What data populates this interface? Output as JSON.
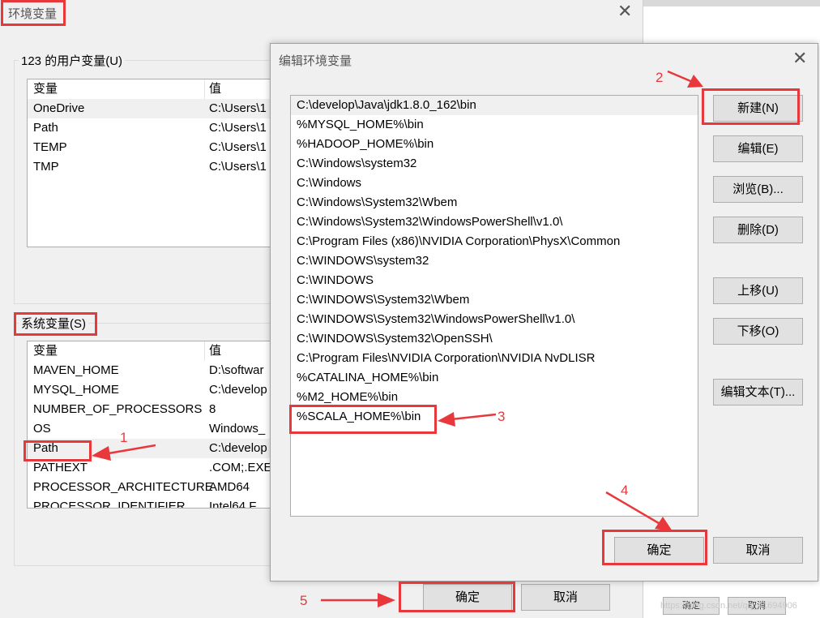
{
  "background_window": {
    "ok_label": "确定",
    "cancel_label": "取消",
    "watermark": "https://blog.csdn.net/qq_41694906"
  },
  "env_dialog": {
    "title": "环境变量",
    "user_section": {
      "label": "123 的用户变量(U)",
      "columns": [
        "变量",
        "值"
      ],
      "rows": [
        {
          "name": "OneDrive",
          "value": "C:\\Users\\1"
        },
        {
          "name": "Path",
          "value": "C:\\Users\\1"
        },
        {
          "name": "TEMP",
          "value": "C:\\Users\\1"
        },
        {
          "name": "TMP",
          "value": "C:\\Users\\1"
        }
      ]
    },
    "system_section": {
      "label": "系统变量(S)",
      "columns": [
        "变量",
        "值"
      ],
      "rows": [
        {
          "name": "MAVEN_HOME",
          "value": "D:\\softwar"
        },
        {
          "name": "MYSQL_HOME",
          "value": "C:\\develop"
        },
        {
          "name": "NUMBER_OF_PROCESSORS",
          "value": "8"
        },
        {
          "name": "OS",
          "value": "Windows_"
        },
        {
          "name": "Path",
          "value": "C:\\develop"
        },
        {
          "name": "PATHEXT",
          "value": ".COM;.EXE"
        },
        {
          "name": "PROCESSOR_ARCHITECTURE",
          "value": "AMD64"
        },
        {
          "name": "PROCESSOR_IDENTIFIER",
          "value": "Intel64 F"
        }
      ]
    },
    "ok_label": "确定",
    "cancel_label": "取消"
  },
  "edit_dialog": {
    "title": "编辑环境变量",
    "entries": [
      "C:\\develop\\Java\\jdk1.8.0_162\\bin",
      "%MYSQL_HOME%\\bin",
      "%HADOOP_HOME%\\bin",
      "C:\\Windows\\system32",
      "C:\\Windows",
      "C:\\Windows\\System32\\Wbem",
      "C:\\Windows\\System32\\WindowsPowerShell\\v1.0\\",
      "C:\\Program Files (x86)\\NVIDIA Corporation\\PhysX\\Common",
      "C:\\WINDOWS\\system32",
      "C:\\WINDOWS",
      "C:\\WINDOWS\\System32\\Wbem",
      "C:\\WINDOWS\\System32\\WindowsPowerShell\\v1.0\\",
      "C:\\WINDOWS\\System32\\OpenSSH\\",
      "C:\\Program Files\\NVIDIA Corporation\\NVIDIA NvDLISR",
      "%CATALINA_HOME%\\bin",
      "%M2_HOME%\\bin",
      "%SCALA_HOME%\\bin"
    ],
    "buttons": {
      "new": "新建(N)",
      "edit": "编辑(E)",
      "browse": "浏览(B)...",
      "delete": "删除(D)",
      "move_up": "上移(U)",
      "move_down": "下移(O)",
      "edit_text": "编辑文本(T)...",
      "ok": "确定",
      "cancel": "取消"
    }
  },
  "annotations": {
    "step1": "1",
    "step2": "2",
    "step3": "3",
    "step4": "4",
    "step5": "5",
    "color": "#e8383c"
  }
}
